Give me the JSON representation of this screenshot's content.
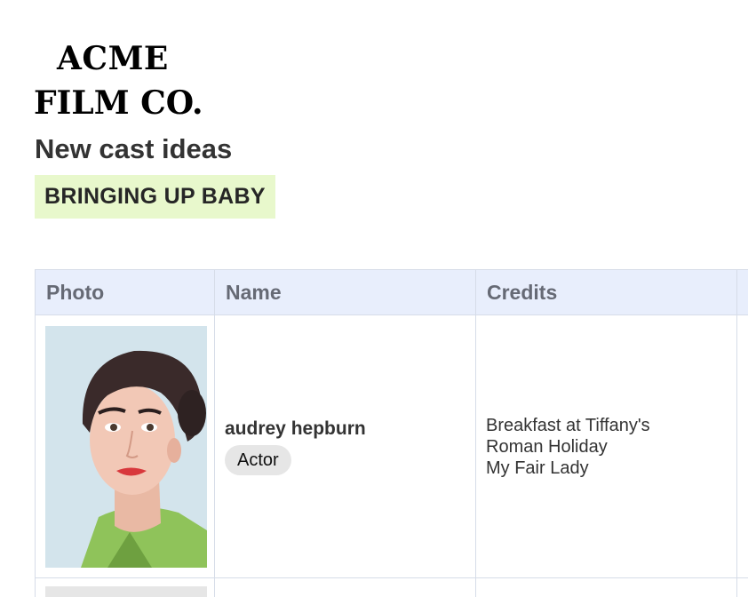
{
  "logo": {
    "line1": "ACME",
    "line2": "FILM CO."
  },
  "page_title": "New cast ideas",
  "project": {
    "name": "BRINGING UP BABY",
    "color": "#e8f8cc"
  },
  "table": {
    "columns": [
      "Photo",
      "Name",
      "Credits"
    ],
    "rows": [
      {
        "name": "audrey hepburn",
        "role": "Actor",
        "credits": [
          "Breakfast at Tiffany's",
          "Roman Holiday",
          "My Fair Lady"
        ]
      }
    ]
  },
  "colors": {
    "header_bg": "#e8eefc",
    "border": "#d6dce8",
    "badge_bg": "#e6e6e6"
  }
}
